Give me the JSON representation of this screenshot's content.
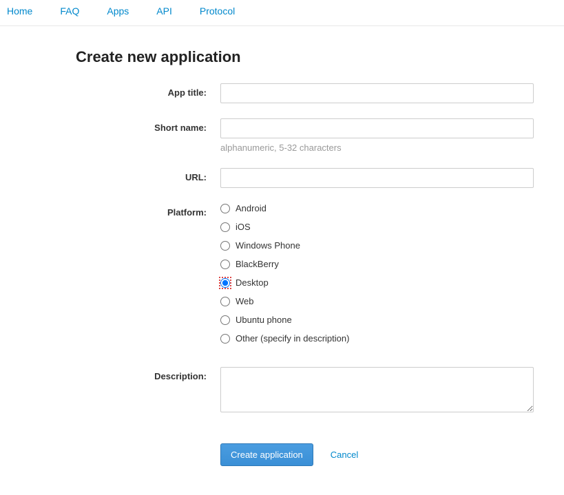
{
  "nav": {
    "items": [
      {
        "label": "Home"
      },
      {
        "label": "FAQ"
      },
      {
        "label": "Apps"
      },
      {
        "label": "API"
      },
      {
        "label": "Protocol"
      }
    ]
  },
  "page": {
    "title": "Create new application"
  },
  "form": {
    "app_title": {
      "label": "App title:",
      "value": ""
    },
    "short_name": {
      "label": "Short name:",
      "value": "",
      "help": "alphanumeric, 5-32 characters"
    },
    "url": {
      "label": "URL:",
      "value": ""
    },
    "platform": {
      "label": "Platform:",
      "options": [
        {
          "label": "Android",
          "checked": false
        },
        {
          "label": "iOS",
          "checked": false
        },
        {
          "label": "Windows Phone",
          "checked": false
        },
        {
          "label": "BlackBerry",
          "checked": false
        },
        {
          "label": "Desktop",
          "checked": true
        },
        {
          "label": "Web",
          "checked": false
        },
        {
          "label": "Ubuntu phone",
          "checked": false
        },
        {
          "label": "Other (specify in description)",
          "checked": false
        }
      ]
    },
    "description": {
      "label": "Description:",
      "value": ""
    }
  },
  "actions": {
    "submit": "Create application",
    "cancel": "Cancel"
  }
}
